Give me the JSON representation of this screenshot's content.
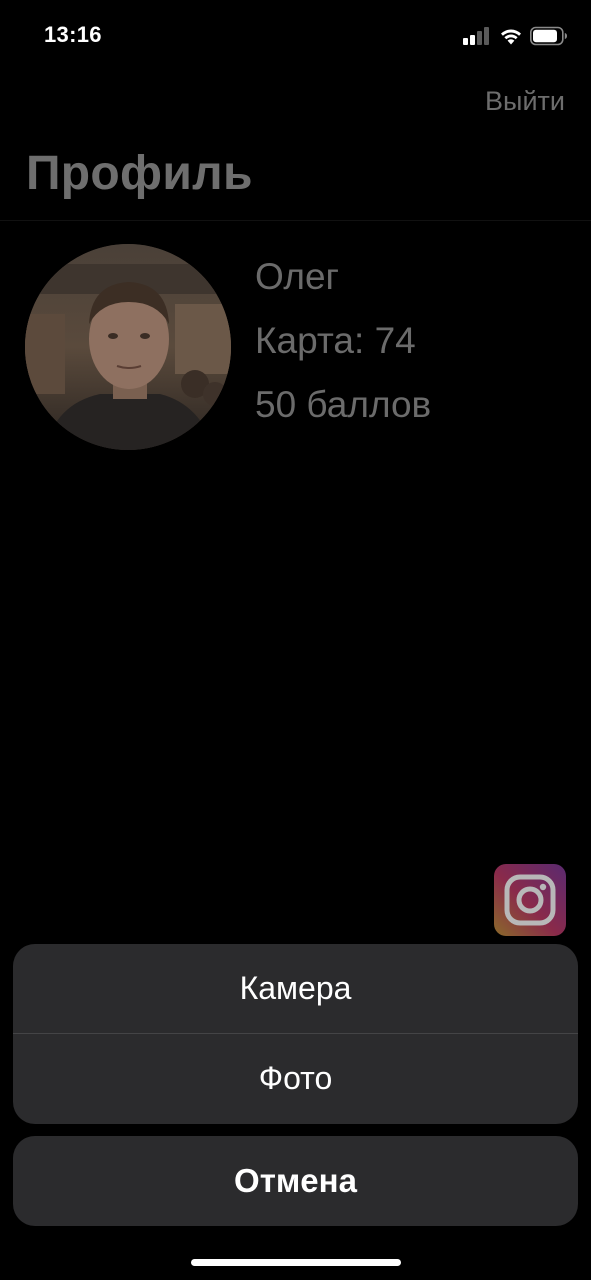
{
  "status_bar": {
    "time": "13:16",
    "icons": [
      "signal-icon",
      "wifi-icon",
      "battery-icon"
    ]
  },
  "header": {
    "logout_label": "Выйти",
    "title": "Профиль"
  },
  "profile": {
    "name": "Олег",
    "card": "Карта: 74",
    "points": "50 баллов"
  },
  "social": {
    "icon": "instagram-icon"
  },
  "action_sheet": {
    "options": [
      "Камера",
      "Фото"
    ],
    "cancel_label": "Отмена"
  },
  "colors": {
    "background": "#000000",
    "sheet_background": "#2b2b2d",
    "dimmed_text": "#6e6e6e"
  }
}
